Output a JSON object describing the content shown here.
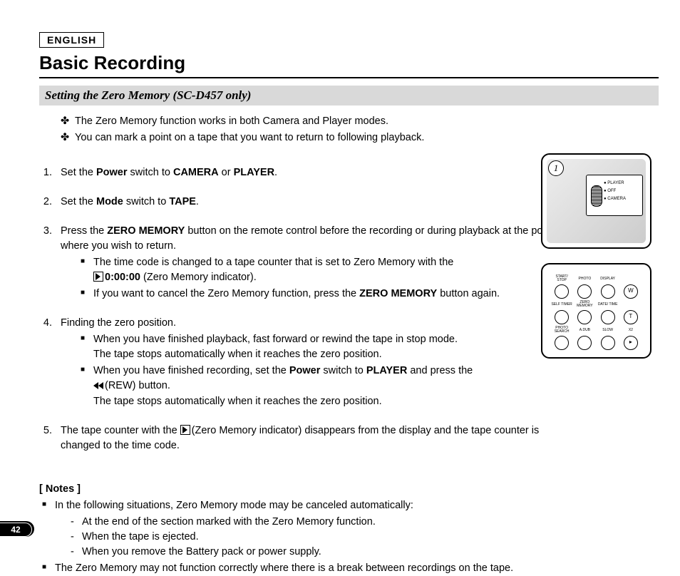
{
  "lang": "ENGLISH",
  "title": "Basic Recording",
  "subtitle": "Setting the Zero Memory (SC-D457 only)",
  "intro": [
    "The Zero Memory function works in both Camera and Player modes.",
    "You can mark a point on a tape that you want to return to following playback."
  ],
  "steps": {
    "s1_a": "Set the ",
    "s1_b": "Power",
    "s1_c": " switch to ",
    "s1_d": "CAMERA",
    "s1_e": " or ",
    "s1_f": "PLAYER",
    "s1_g": ".",
    "s2_a": "Set the ",
    "s2_b": "Mode",
    "s2_c": " switch to ",
    "s2_d": "TAPE",
    "s2_e": ".",
    "s3_a": "Press the ",
    "s3_b": "ZERO MEMORY",
    "s3_c": " button on the remote control before the recording or during playback at the point where you wish to return.",
    "s3_sub1_a": "The time code is changed to a tape counter that is set to Zero Memory with the",
    "s3_sub1_b": "0:00:00",
    "s3_sub1_c": " (Zero Memory indicator).",
    "s3_sub2_a": "If you want to cancel the Zero Memory function, press the ",
    "s3_sub2_b": "ZERO MEMORY",
    "s3_sub2_c": " button again.",
    "s4": "Finding the zero position.",
    "s4_sub1_a": "When you have finished playback, fast forward or rewind the tape in stop mode.",
    "s4_sub1_b": "The tape stops automatically when it reaches the zero position.",
    "s4_sub2_a": "When you have finished recording, set the ",
    "s4_sub2_b": "Power",
    "s4_sub2_c": " switch to ",
    "s4_sub2_d": "PLAYER",
    "s4_sub2_e": " and press the",
    "s4_sub2_f": "(REW) button.",
    "s4_sub2_g": "The tape stops automatically when it reaches the zero position.",
    "s5": "The tape counter with the      (Zero Memory indicator) disappears from the display and the tape counter is changed to the time code."
  },
  "notes_head": "[ Notes ]",
  "notes": {
    "n1": "In the following situations, Zero Memory mode may be canceled automatically:",
    "n1_d1": "At the end of the section marked with the Zero Memory function.",
    "n1_d2": "When the tape is ejected.",
    "n1_d3": "When you remove the Battery pack or power supply.",
    "n2": "The Zero Memory may not function correctly where there is a break between recordings on the tape."
  },
  "fig1": {
    "num": "1",
    "opt1": "PLAYER",
    "opt2": "OFF",
    "opt3": "CAMERA"
  },
  "fig2": {
    "b1": "START/\nSTOP",
    "b2": "PHOTO",
    "b3": "DISPLAY",
    "b4": "W",
    "b5": "SELF\nTIMER",
    "b6": "ZERO\nMEMORY",
    "b7": "DATE/\nTIME",
    "b8": "T",
    "b9": "PHOTO\nSEARCH",
    "b10": "A.DUB",
    "b11": "SLOW",
    "b12": "X2"
  },
  "page_num": "42"
}
